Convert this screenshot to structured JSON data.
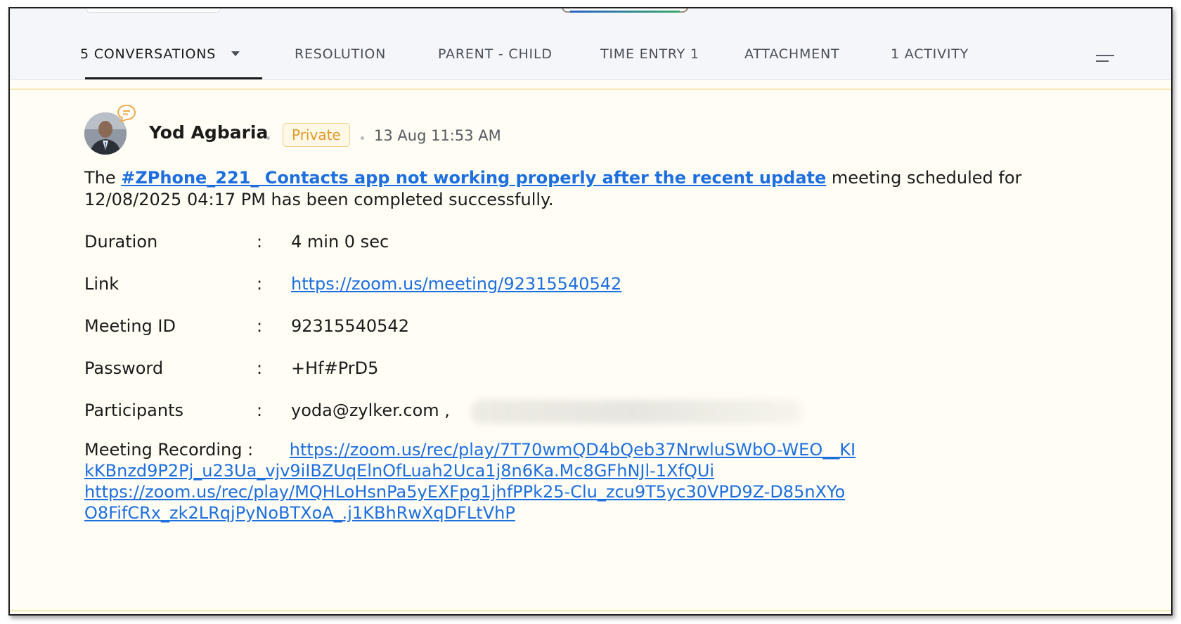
{
  "tabs": [
    {
      "label": "5 CONVERSATIONS",
      "active": true,
      "has_dropdown": true
    },
    {
      "label": "RESOLUTION"
    },
    {
      "label": "PARENT - CHILD"
    },
    {
      "label": "TIME ENTRY 1"
    },
    {
      "label": "ATTACHMENT"
    },
    {
      "label": "1 ACTIVITY"
    }
  ],
  "message": {
    "author": "Yod Agbaria",
    "visibility_badge": "Private",
    "timestamp": "13 Aug 11:53 AM",
    "intro_prefix": "The ",
    "ticket_link": "#ZPhone_221_ Contacts app not working properly after the recent update",
    "intro_suffix": " meeting scheduled for 12/08/2025 04:17 PM has been completed successfully.",
    "fields": [
      {
        "label": "Duration",
        "colon": ":",
        "value": "4 min 0 sec"
      },
      {
        "label": "Link",
        "colon": ":",
        "value": "https://zoom.us/meeting/92315540542",
        "is_link": true
      },
      {
        "label": "Meeting ID",
        "colon": ":",
        "value": "92315540542"
      },
      {
        "label": "Password",
        "colon": ":",
        "value": "+Hf#PrD5"
      },
      {
        "label": "Participants",
        "colon": ":",
        "value": "yoda@zylker.com , "
      }
    ],
    "recording_label": "Meeting Recording :",
    "recording_links": [
      "https://zoom.us/rec/play/7T70wmQD4bQeb37NrwluSWbO-WEO__KIkKBnzd9P2Pj_u23Ua_vjv9iIBZUqElnOfLuah2Uca1j8n6Ka.Mc8GFhNJl-1XfQUi",
      "https://zoom.us/rec/play/MQHLoHsnPa5yEXFpg1jhfPPk25-Clu_zcu9T5yc30VPD9Z-D85nXYoO8FifCRx_zk2LRqjPyNoBTXoA_.j1KBhRwXqDFLtVhP"
    ]
  },
  "colors": {
    "link": "#1d6fe0",
    "badge_text": "#e29a2a",
    "badge_border": "#f3cf8a",
    "content_bg": "#fffdf4",
    "tabbar_bg": "#f4f6fa"
  }
}
